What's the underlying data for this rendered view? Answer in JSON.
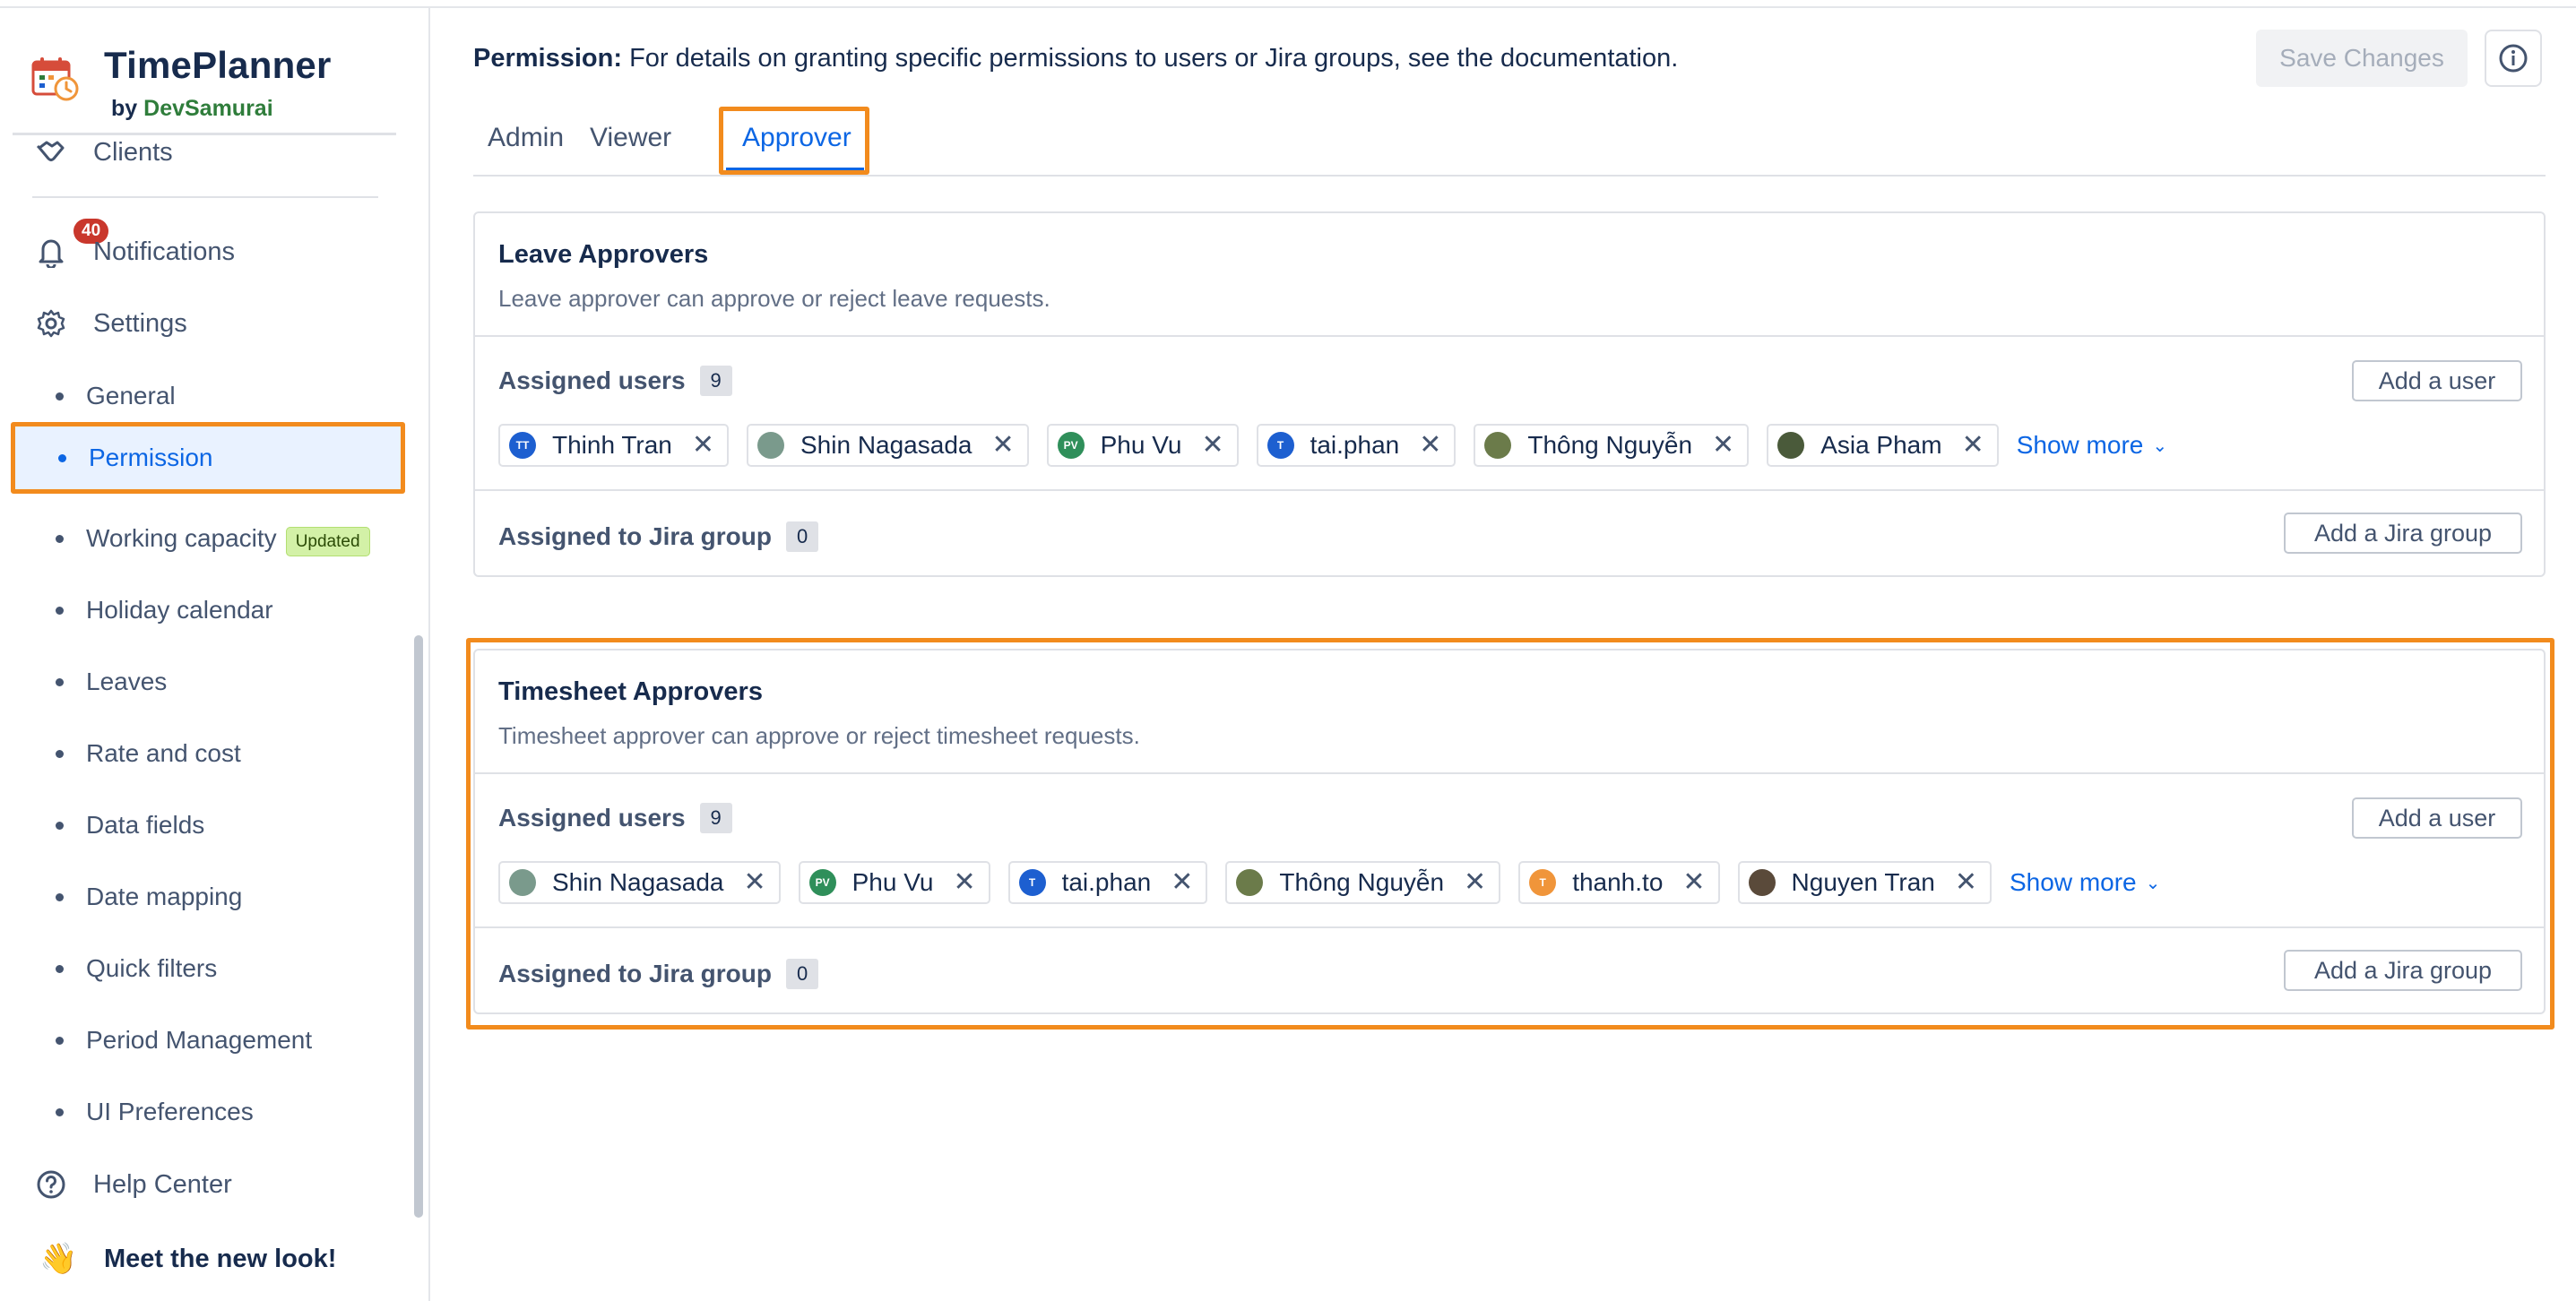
{
  "app": {
    "name": "TimePlanner",
    "by": "by",
    "vendor": "DevSamurai"
  },
  "sidebar": {
    "clients": "Clients",
    "notifications": {
      "label": "Notifications",
      "count": "40"
    },
    "settings": "Settings",
    "sub_items": [
      {
        "label": "General"
      },
      {
        "label": "Permission",
        "active": true
      },
      {
        "label": "Working capacity",
        "badge": "Updated"
      },
      {
        "label": "Holiday calendar"
      },
      {
        "label": "Leaves"
      },
      {
        "label": "Rate and cost"
      },
      {
        "label": "Data fields"
      },
      {
        "label": "Date mapping"
      },
      {
        "label": "Quick filters"
      },
      {
        "label": "Period Management"
      },
      {
        "label": "UI Preferences"
      }
    ],
    "help": "Help Center",
    "meet": "Meet the new look!"
  },
  "header": {
    "permission_label": "Permission:",
    "permission_text": "For details on granting specific permissions to users or Jira groups, see the documentation.",
    "save_label": "Save Changes"
  },
  "tabs": [
    {
      "label": "Admin"
    },
    {
      "label": "Viewer"
    },
    {
      "label": "Approver",
      "active": true
    }
  ],
  "leave": {
    "title": "Leave Approvers",
    "desc": "Leave approver can approve or reject leave requests.",
    "assigned_users_label": "Assigned users",
    "assigned_users_count": "9",
    "add_user": "Add a user",
    "users": [
      {
        "name": "Thinh Tran",
        "initials": "TT",
        "color": "#1d5fd0"
      },
      {
        "name": "Shin Nagasada",
        "initials": "",
        "color": "#7a9a8c"
      },
      {
        "name": "Phu Vu",
        "initials": "PV",
        "color": "#2f8f5a"
      },
      {
        "name": "tai.phan",
        "initials": "T",
        "color": "#1d5fd0"
      },
      {
        "name": "Thông Nguyễn",
        "initials": "",
        "color": "#6b7b4a"
      },
      {
        "name": "Asia Pham",
        "initials": "",
        "color": "#4a5a3a"
      }
    ],
    "show_more": "Show more",
    "group_label": "Assigned to Jira group",
    "group_count": "0",
    "add_group": "Add a Jira group"
  },
  "timesheet": {
    "title": "Timesheet Approvers",
    "desc": "Timesheet approver can approve or reject timesheet requests.",
    "assigned_users_label": "Assigned users",
    "assigned_users_count": "9",
    "add_user": "Add a user",
    "users": [
      {
        "name": "Shin Nagasada",
        "initials": "",
        "color": "#7a9a8c"
      },
      {
        "name": "Phu Vu",
        "initials": "PV",
        "color": "#2f8f5a"
      },
      {
        "name": "tai.phan",
        "initials": "T",
        "color": "#1d5fd0"
      },
      {
        "name": "Thông Nguyễn",
        "initials": "",
        "color": "#6b7b4a"
      },
      {
        "name": "thanh.to",
        "initials": "T",
        "color": "#f0953a"
      },
      {
        "name": "Nguyen Tran",
        "initials": "",
        "color": "#5a4a3a"
      }
    ],
    "show_more": "Show more",
    "group_label": "Assigned to Jira group",
    "group_count": "0",
    "add_group": "Add a Jira group"
  },
  "colors": {
    "accent": "#0c66e4",
    "highlight": "#f28b1d",
    "notif_badge": "#c9372c"
  }
}
